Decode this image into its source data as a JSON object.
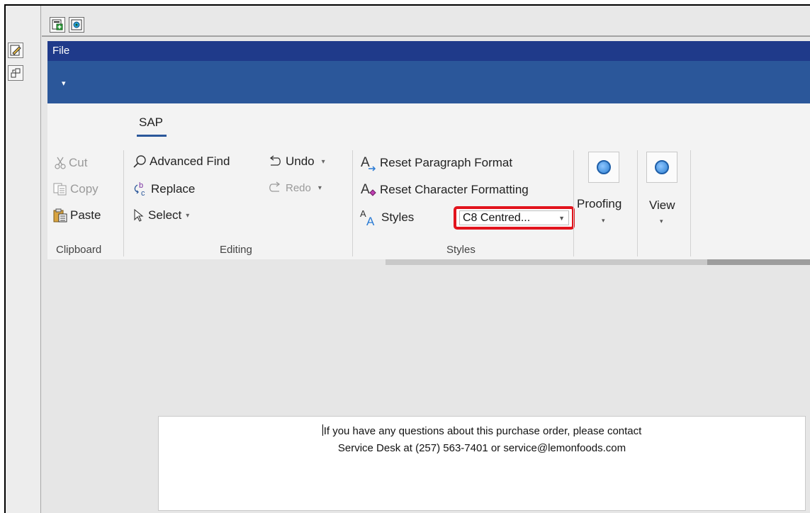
{
  "menu": {
    "file_label": "File",
    "qat_arrow": "▾"
  },
  "ribbon": {
    "tab": "SAP",
    "clipboard": {
      "cut": "Cut",
      "copy": "Copy",
      "paste": "Paste",
      "group_label": "Clipboard"
    },
    "editing": {
      "advanced_find": "Advanced Find",
      "replace": "Replace",
      "select": "Select",
      "undo": "Undo",
      "redo": "Redo",
      "group_label": "Editing"
    },
    "styles": {
      "reset_paragraph": "Reset Paragraph Format",
      "reset_character": "Reset Character Formatting",
      "styles_label": "Styles",
      "current_style": "C8 Centred...",
      "group_label": "Styles"
    },
    "proofing_label": "Proofing",
    "view_label": "View"
  },
  "document": {
    "line1": "If you have any questions about this purchase order, please contact",
    "line2": "Service Desk at (257) 563-7401 or service@lemonfoods.com"
  },
  "colors": {
    "highlight": "#e2141d",
    "title_bar": "#1f3a8a",
    "ribbon_header": "#2b579a"
  }
}
